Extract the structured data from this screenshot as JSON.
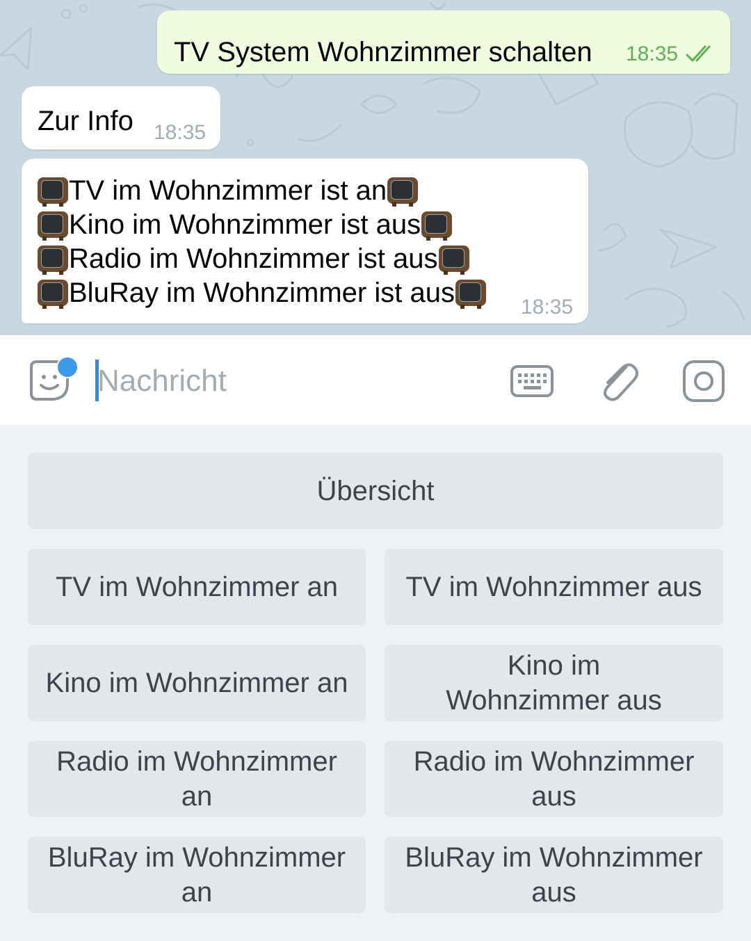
{
  "messages": {
    "outgoing": {
      "text": "TV System Wohnzimmer schalten",
      "time": "18:35",
      "status_icon": "double-check-icon",
      "status_color": "#5fae57"
    },
    "incoming_1": {
      "text": "Zur Info",
      "time": "18:35"
    },
    "incoming_2": {
      "lines": [
        "TV im Wohnzimmer ist an",
        "Kino im Wohnzimmer ist aus",
        "Radio im Wohnzimmer ist aus",
        "BluRay im Wohnzimmer ist aus"
      ],
      "line_icon": "television-emoji",
      "time": "18:35"
    }
  },
  "composer": {
    "placeholder": "Nachricht",
    "value": "",
    "icons": [
      "sticker-icon",
      "keyboard-icon",
      "paperclip-icon",
      "camera-icon"
    ],
    "accent_color": "#3d9ae8"
  },
  "bot_keyboard": {
    "overview": "Übersicht",
    "buttons": [
      "TV im Wohnzimmer an",
      "TV im Wohnzimmer aus",
      "Kino im Wohnzimmer an",
      "Kino im Wohnzimmer aus",
      "Radio im Wohnzimmer an",
      "Radio im Wohnzimmer aus",
      "BluRay im Wohnzimmer an",
      "BluRay im Wohnzimmer aus"
    ]
  },
  "colors": {
    "chat_background": "#c9d7e2",
    "outgoing_bubble": "#effdde",
    "incoming_bubble": "#ffffff",
    "keyboard_button": "#e3e7eb"
  }
}
